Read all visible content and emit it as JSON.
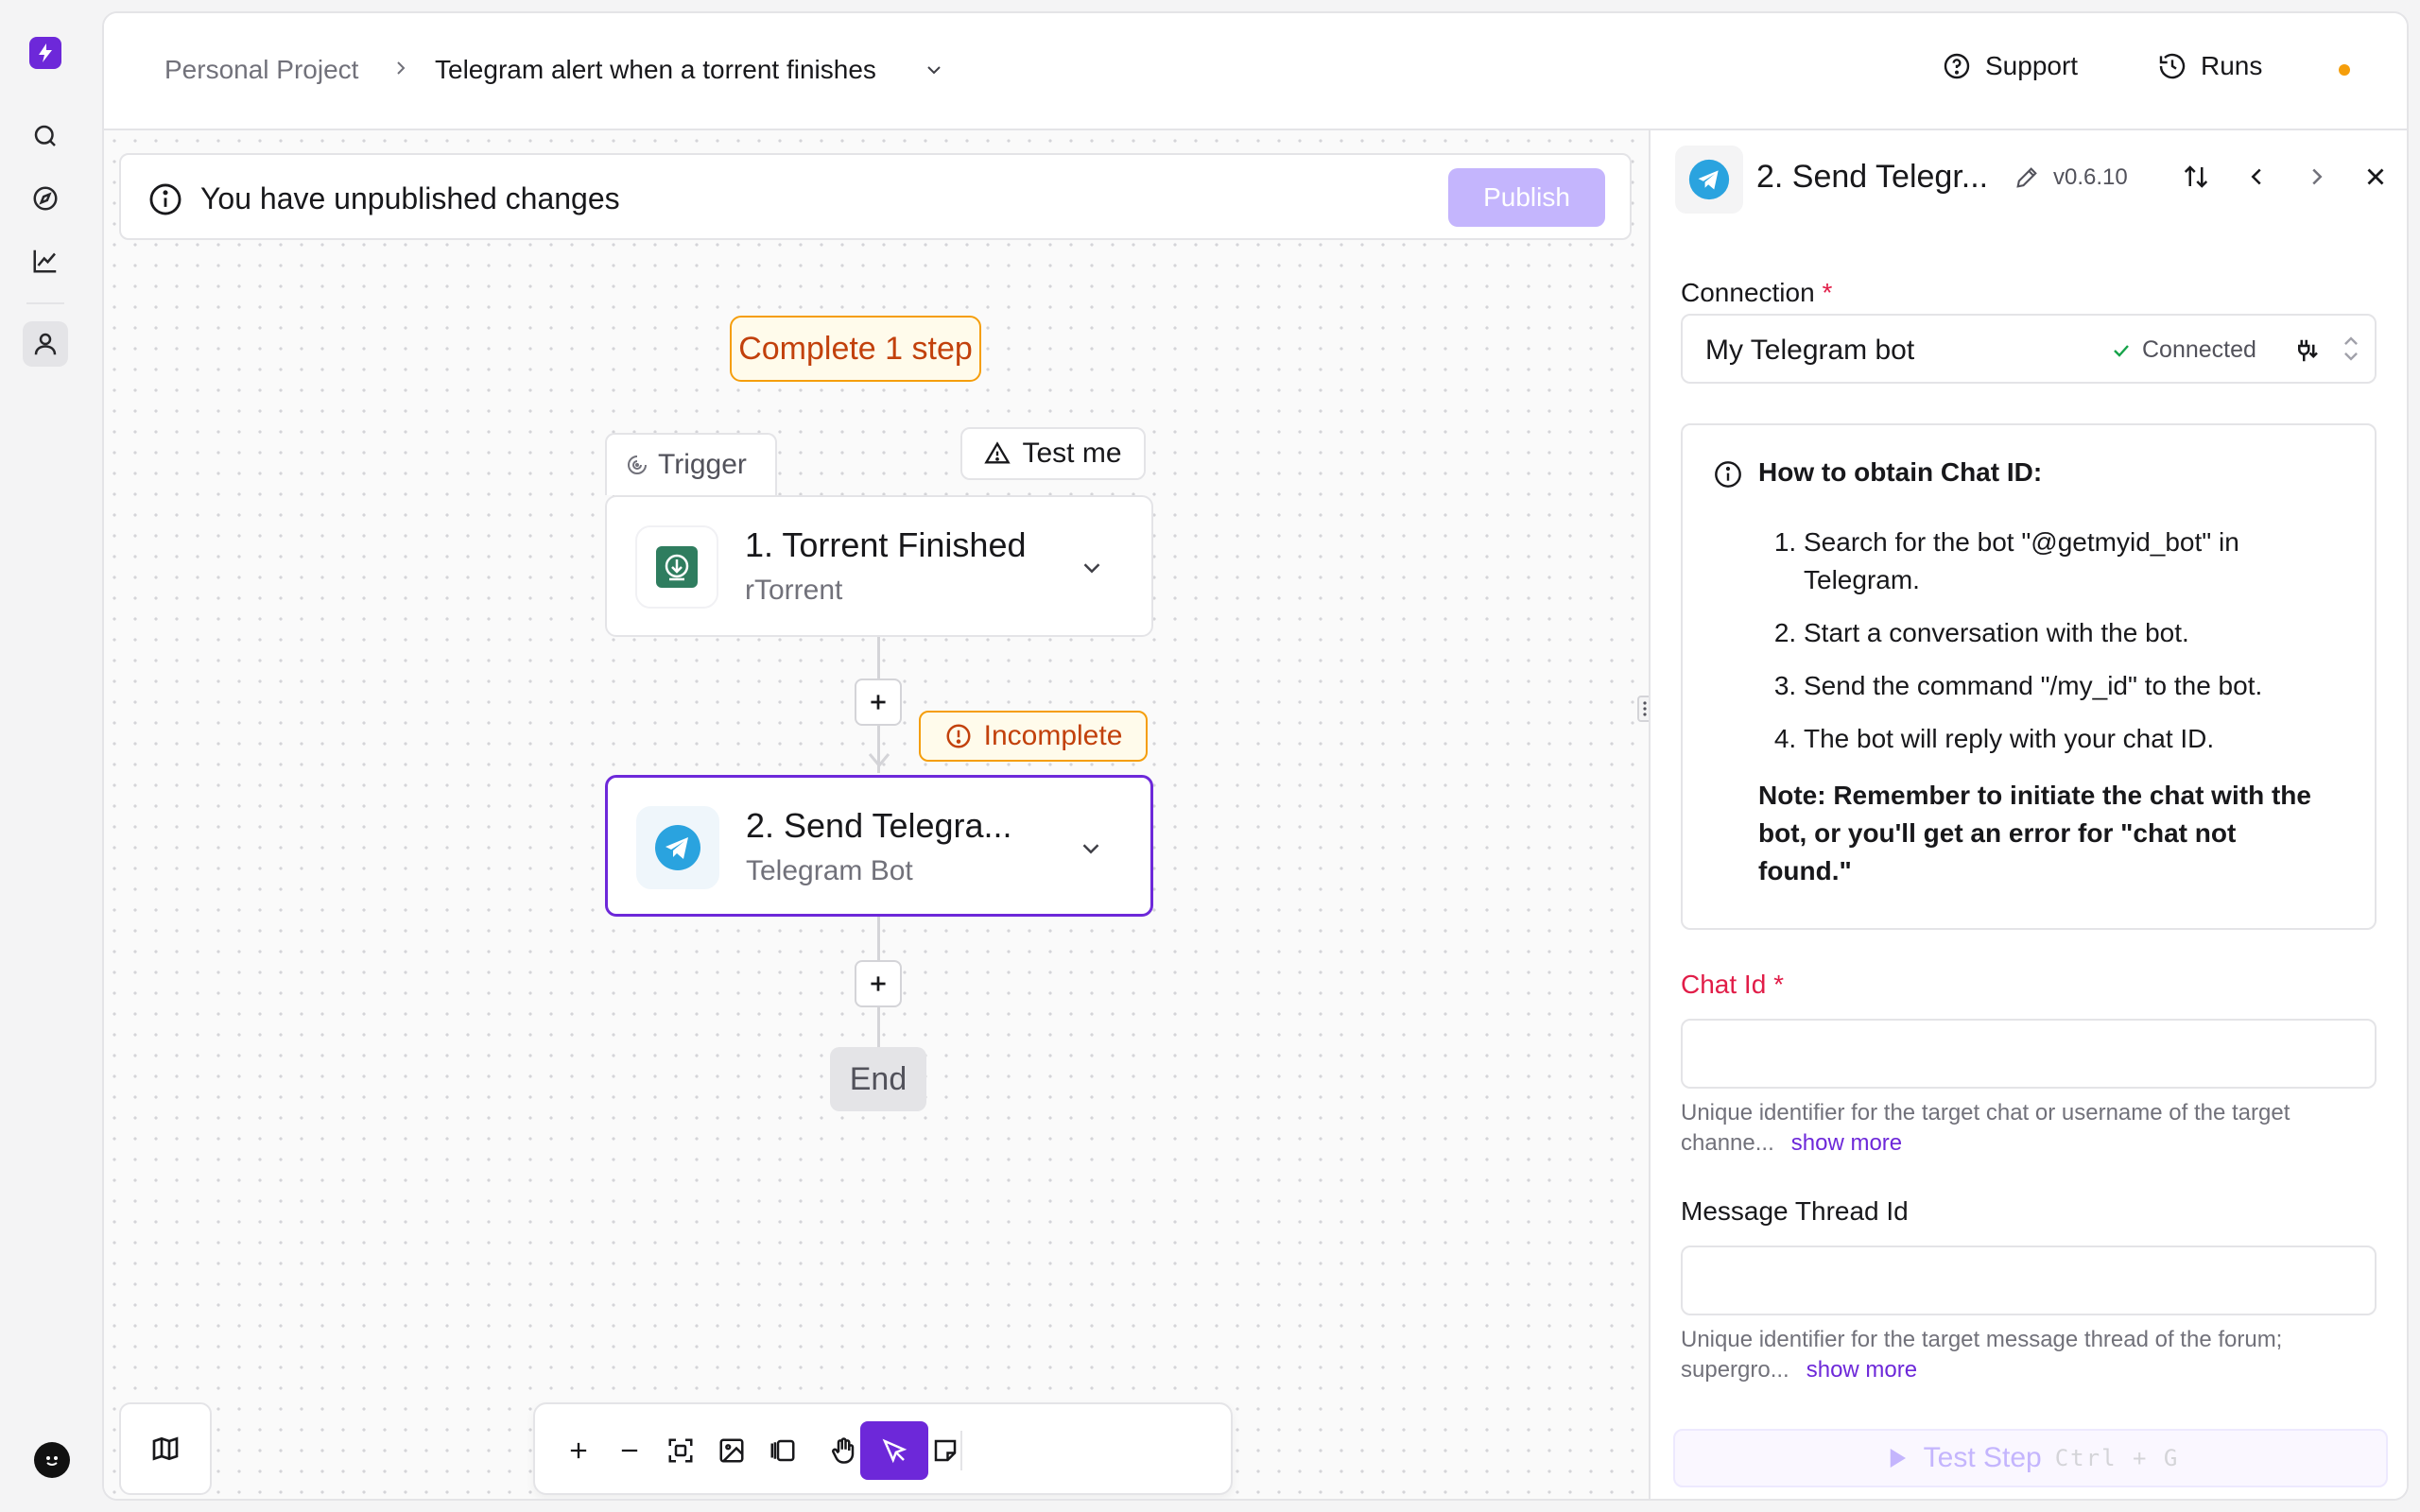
{
  "header": {
    "project": "Personal Project",
    "flow_name": "Telegram alert when a torrent finishes",
    "support": "Support",
    "runs": "Runs"
  },
  "banner": {
    "text": "You have unpublished changes",
    "publish": "Publish"
  },
  "canvas": {
    "complete_badge": "Complete 1 step",
    "trigger_tab": "Trigger",
    "test_me": "Test me",
    "step1": {
      "title": "1. Torrent Finished",
      "subtitle": "rTorrent"
    },
    "step2": {
      "title": "2. Send Telegra...",
      "subtitle": "Telegram Bot"
    },
    "incomplete": "Incomplete",
    "end": "End"
  },
  "panel": {
    "title": "2. Send Telegr...",
    "version": "v0.6.10",
    "connection": {
      "label": "Connection",
      "required_mark": "*",
      "value": "My Telegram bot",
      "status": "Connected"
    },
    "info": {
      "heading": "How to obtain Chat ID:",
      "steps": [
        "Search for the bot \"@getmyid_bot\" in Telegram.",
        "Start a conversation with the bot.",
        "Send the command \"/my_id\" to the bot.",
        "The bot will reply with your chat ID."
      ],
      "note": "Note: Remember to initiate the chat with the bot, or you'll get an error for \"chat not found.\""
    },
    "chat_id": {
      "label": "Chat Id",
      "required_mark": "*",
      "value": "",
      "help": "Unique identifier for the target chat or username of the target channe...",
      "show_more": "show more"
    },
    "thread_id": {
      "label": "Message Thread Id",
      "value": "",
      "help": "Unique identifier for the target message thread of the forum; supergro...",
      "show_more": "show more"
    },
    "test_step": {
      "label": "Test Step",
      "shortcut": "Ctrl + G"
    }
  },
  "colors": {
    "accent": "#6d28d9",
    "warning": "#f59e0b",
    "required": "#e11d48",
    "telegram": "#2aa3df",
    "rtorrent": "#2f7d5f"
  }
}
